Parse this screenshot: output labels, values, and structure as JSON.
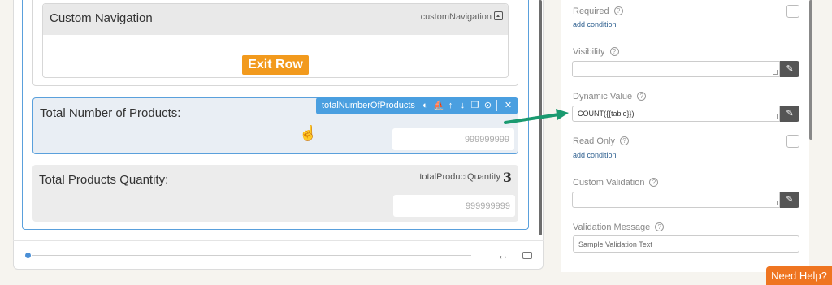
{
  "canvas": {
    "custom_navigation": {
      "title": "Custom Navigation",
      "key": "customNavigation",
      "exit_row_label": "Exit Row"
    },
    "selected_field": {
      "label": "Total Number of Products:",
      "key": "totalNumberOfProducts",
      "placeholder": "999999999"
    },
    "field2": {
      "label": "Total Products Quantity:",
      "key": "totalProductQuantity",
      "key_number": "3",
      "placeholder": "999999999"
    },
    "toolbar_icons": [
      "palette-icon",
      "style-icon",
      "arrow-up-icon",
      "arrow-down-icon",
      "copy-icon",
      "comment-icon",
      "close-icon"
    ]
  },
  "panel": {
    "required": {
      "label": "Required",
      "link": "add condition"
    },
    "visibility": {
      "label": "Visibility"
    },
    "dynamic_value": {
      "label": "Dynamic Value",
      "value": "COUNT({{table}})"
    },
    "read_only": {
      "label": "Read Only",
      "link": "add condition"
    },
    "custom_validation": {
      "label": "Custom Validation"
    },
    "validation_message": {
      "label": "Validation Message",
      "placeholder": "Sample Validation Text"
    }
  },
  "need_help": "Need Help?",
  "colors": {
    "accent_blue": "#4a9fe0",
    "exit_orange": "#f29a1d",
    "help_orange": "#ef7521",
    "arrow_green": "#1a9a70"
  }
}
